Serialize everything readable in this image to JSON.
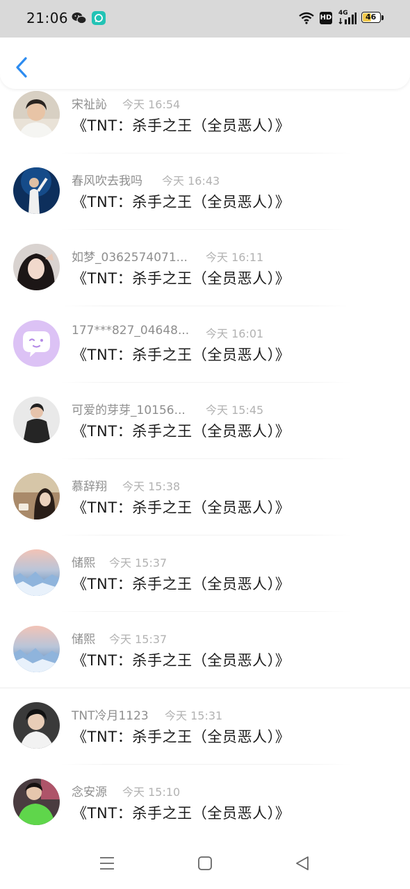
{
  "status_bar": {
    "time": "21:06",
    "icons": [
      "wechat-icon",
      "app-notification-icon",
      "wifi-icon",
      "hd-icon",
      "4g-signal-icon",
      "battery-icon"
    ],
    "network_label": "4G",
    "hd_label": "HD",
    "battery": "46"
  },
  "header": {
    "back_icon": "chevron-left-icon",
    "accent_color": "#2d8cf0"
  },
  "items": [
    {
      "name": "宋祉訫",
      "time": "今天 16:54",
      "message": "《TNT：杀手之王（全员恶人）》",
      "avatar": "avatar-photo-icon"
    },
    {
      "name": "春风吹去我吗",
      "time": "今天 16:43",
      "message": "《TNT：杀手之王（全员恶人）》",
      "avatar": "avatar-photo-icon"
    },
    {
      "name": "如梦_0362574071...",
      "time": "今天 16:11",
      "message": "《TNT：杀手之王（全员恶人）》",
      "avatar": "avatar-photo-icon"
    },
    {
      "name": "177***827_04648...",
      "time": "今天 16:01",
      "message": "《TNT：杀手之王（全员恶人）》",
      "avatar": "default-chat-bubble-icon"
    },
    {
      "name": "可爱的芽芽_10156...",
      "time": "今天 15:45",
      "message": "《TNT：杀手之王（全员恶人）》",
      "avatar": "avatar-photo-icon"
    },
    {
      "name": "慕辞翔",
      "time": "今天 15:38",
      "message": "《TNT：杀手之王（全员恶人）》",
      "avatar": "avatar-photo-icon"
    },
    {
      "name": "储熙",
      "time": "今天 15:37",
      "message": "《TNT：杀手之王（全员恶人）》",
      "avatar": "avatar-photo-icon"
    },
    {
      "name": "储熙",
      "time": "今天 15:37",
      "message": "《TNT：杀手之王（全员恶人）》",
      "avatar": "avatar-photo-icon"
    },
    {
      "name": "TNT冷月1123",
      "time": "今天 15:31",
      "message": "《TNT：杀手之王（全员恶人）》",
      "avatar": "avatar-photo-icon"
    },
    {
      "name": "念安源",
      "time": "今天 15:10",
      "message": "《TNT：杀手之王（全员恶人）》",
      "avatar": "avatar-photo-icon"
    }
  ],
  "nav_bar": {
    "icons": [
      "menu-icon",
      "home-icon",
      "back-triangle-icon"
    ]
  }
}
